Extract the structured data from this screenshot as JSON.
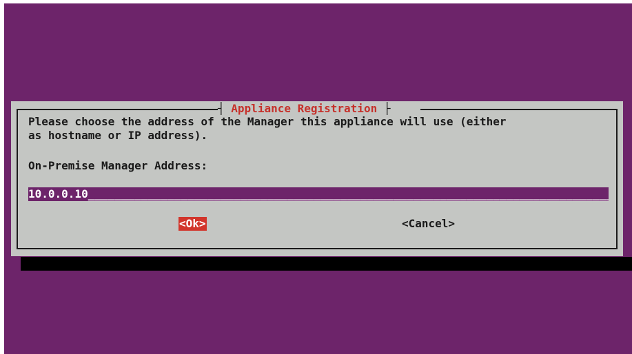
{
  "dialog": {
    "title": "Appliance Registration",
    "message": "Please choose the address of the Manager this appliance will use (either\nas hostname or IP address).",
    "field_label": "On-Premise Manager Address:",
    "field_value": "10.0.0.10"
  },
  "buttons": {
    "ok_label": "<Ok>",
    "cancel_label": "<Cancel>"
  },
  "colors": {
    "background": "#6d246a",
    "dialog": "#c4c6c3",
    "accent": "#d2352b",
    "title": "#c6312b"
  }
}
